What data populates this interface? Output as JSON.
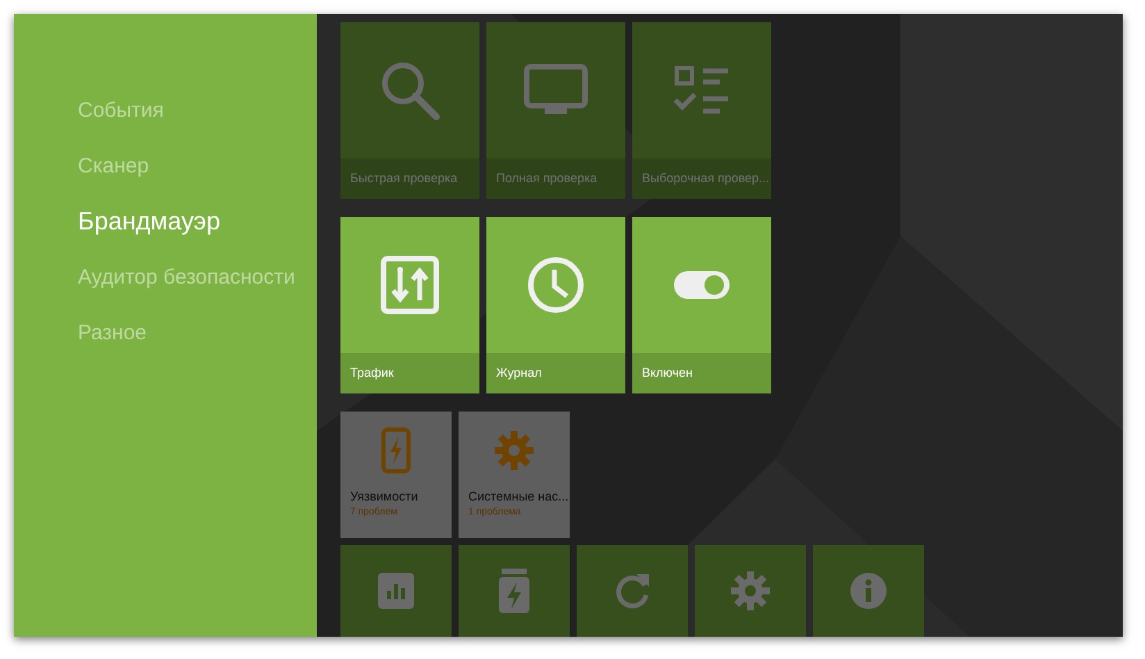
{
  "sidebar": {
    "items": [
      {
        "label": "События",
        "selected": false
      },
      {
        "label": "Сканер",
        "selected": false
      },
      {
        "label": "Брандмауэр",
        "selected": true
      },
      {
        "label": "Аудитор безопасности",
        "selected": false
      },
      {
        "label": "Разное",
        "selected": false
      }
    ]
  },
  "sections": [
    {
      "dimmed": true,
      "kind": "large",
      "tiles": [
        {
          "label": "Быстрая проверка"
        },
        {
          "label": "Полная проверка"
        },
        {
          "label": "Выборочная провер..."
        }
      ]
    },
    {
      "dimmed": false,
      "kind": "large",
      "tiles": [
        {
          "label": "Трафик"
        },
        {
          "label": "Журнал"
        },
        {
          "label": "Включен",
          "on": true
        }
      ]
    },
    {
      "dimmed": true,
      "kind": "issue",
      "tiles": [
        {
          "label": "Уязвимости",
          "note": "7 проблем"
        },
        {
          "label": "Системные нас...",
          "note": "1 проблема"
        }
      ]
    },
    {
      "dimmed": true,
      "kind": "small"
    }
  ]
}
